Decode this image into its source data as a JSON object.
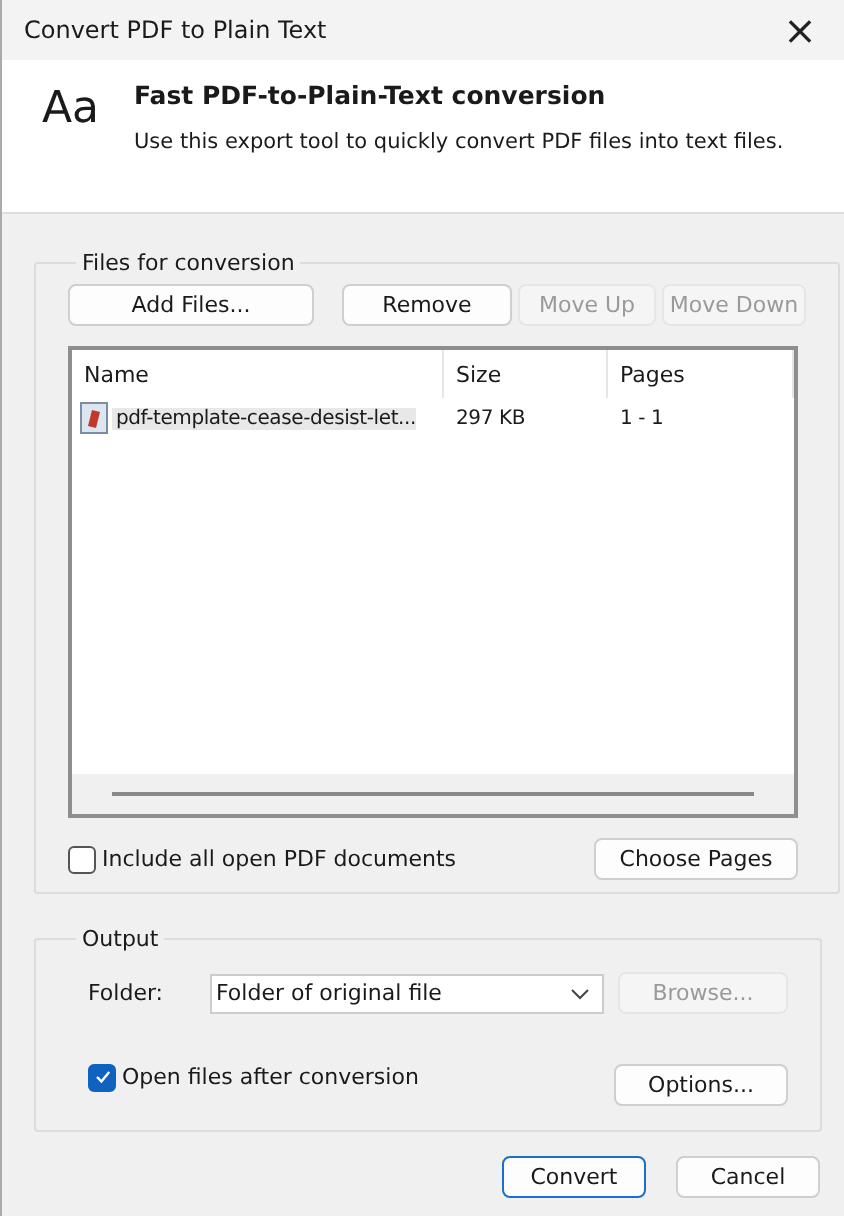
{
  "window": {
    "title": "Convert PDF to Plain Text",
    "close": "×"
  },
  "header": {
    "glyph": "Aa",
    "heading": "Fast PDF-to-Plain-Text conversion",
    "description": "Use this export tool to quickly convert PDF files into text files."
  },
  "files_group": {
    "label": "Files for conversion",
    "buttons": [
      {
        "label": "Add Files...",
        "disabled": false
      },
      {
        "label": "Remove",
        "disabled": false
      },
      {
        "label": "Move Up",
        "disabled": true
      },
      {
        "label": "Move Down",
        "disabled": true
      }
    ],
    "columns": [
      "Name",
      "Size",
      "Pages"
    ],
    "rows": [
      {
        "name": "pdf-template-cease-desist-let...",
        "size": "297 KB",
        "pages": "1 - 1",
        "selected": true
      }
    ],
    "include_all": {
      "label": "Include all open PDF documents",
      "checked": false
    },
    "choose_pages": "Choose Pages"
  },
  "output": {
    "label": "Output",
    "folder_label": "Folder:",
    "folder_value": "Folder of original file",
    "browse": {
      "label": "Browse...",
      "disabled": true
    },
    "open_after": {
      "label": "Open files after conversion",
      "checked": true
    },
    "options": "Options..."
  },
  "buttons": [
    {
      "label": "Convert",
      "default": true
    },
    {
      "label": "Cancel",
      "default": false
    }
  ]
}
